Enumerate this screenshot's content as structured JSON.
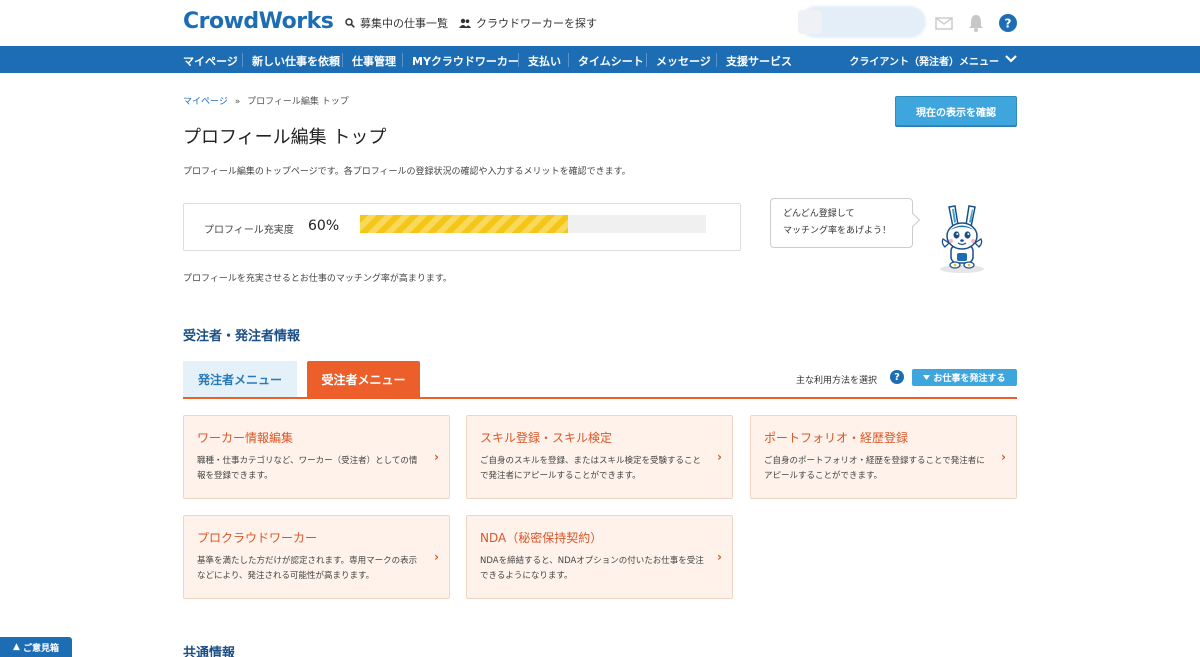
{
  "brand": {
    "logo_text": "CrowdWorks",
    "primary_color": "#1d6db5",
    "accent_color": "#ec5e2a"
  },
  "header": {
    "jobs_link": "募集中の仕事一覧",
    "workers_link": "クラウドワーカーを探す",
    "icons": [
      "search-icon",
      "users-icon",
      "mail-icon",
      "bell-icon",
      "help-icon"
    ]
  },
  "nav": {
    "items": [
      "マイページ",
      "新しい仕事を依頼",
      "仕事管理",
      "MYクラウドワーカー",
      "支払い",
      "タイムシート",
      "メッセージ",
      "支援サービス"
    ],
    "client_menu": "クライアント（発注者）メニュー"
  },
  "breadcrumb": {
    "home": "マイページ",
    "separator": "»",
    "current": "プロフィール編集 トップ"
  },
  "page": {
    "title": "プロフィール編集 トップ",
    "description": "プロフィール編集のトップページです。各プロフィールの登録状況の確認や入力するメリットを確認できます。",
    "confirm_button": "現在の表示を確認"
  },
  "progress": {
    "label": "プロフィール充実度",
    "value_text": "60%",
    "fraction": 0.6,
    "note": "プロフィールを充実させるとお仕事のマッチング率が高まります。",
    "bubble_line1": "どんどん登録して",
    "bubble_line2": "マッチング率をあげよう！"
  },
  "section": {
    "title": "受注者・発注者情報",
    "tab_poster": "発注者メニュー",
    "tab_worker": "受注者メニュー",
    "usage_label": "主な利用方法を選択",
    "usage_button": "お仕事を発注する"
  },
  "cards": [
    {
      "title": "ワーカー情報編集",
      "desc": "職種・仕事カテゴリなど、ワーカー（受注者）としての情報を登録できます。"
    },
    {
      "title": "スキル登録・スキル検定",
      "desc": "ご自身のスキルを登録、またはスキル検定を受験することで発注者にアピールすることができます。"
    },
    {
      "title": "ポートフォリオ・経歴登録",
      "desc": "ご自身のポートフォリオ・経歴を登録することで発注者にアピールすることができます。"
    },
    {
      "title": "プロクラウドワーカー",
      "desc": "基準を満たした方だけが認定されます。専用マークの表示などにより、発注される可能性が高まります。"
    },
    {
      "title": "NDA（秘密保持契約）",
      "desc": "NDAを締結すると、NDAオプションの付いたお仕事を受注できるようになります。"
    }
  ],
  "common_section": {
    "title": "共通情報"
  },
  "feedback": {
    "label": "ご意見箱"
  }
}
